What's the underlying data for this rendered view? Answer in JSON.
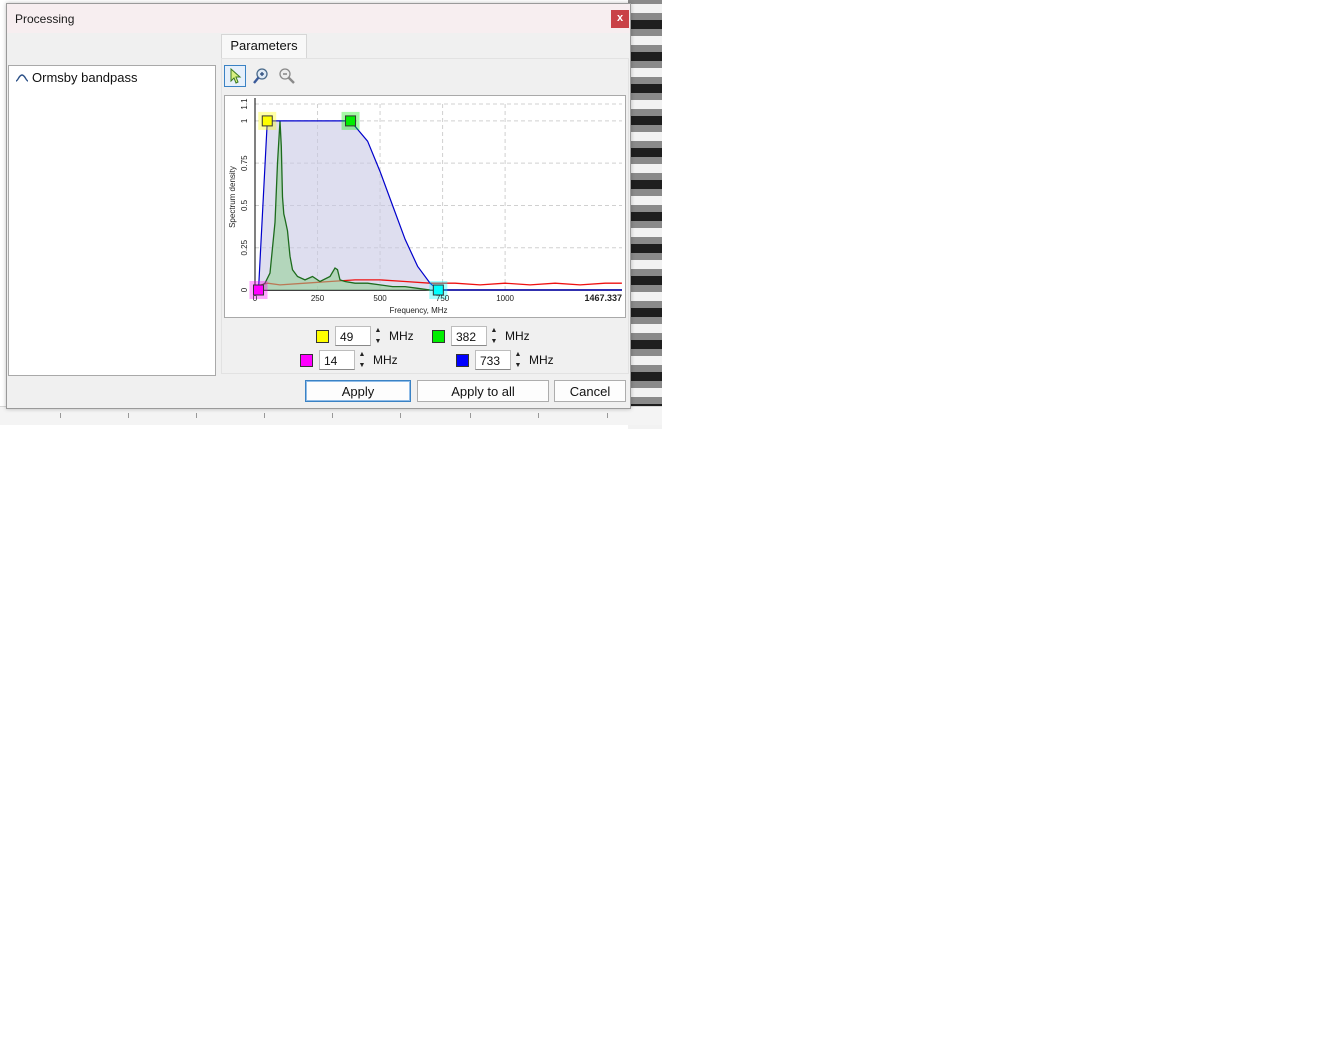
{
  "window": {
    "title": "Processing",
    "close_label": "x"
  },
  "filter_list": {
    "items": [
      {
        "label": "Ormsby bandpass",
        "icon": "bandpass-wave-icon"
      }
    ]
  },
  "tabs": [
    {
      "label": "Parameters"
    }
  ],
  "toolbar": {
    "tools": [
      "pointer-icon",
      "zoom-in-icon",
      "zoom-out-icon"
    ]
  },
  "chart_data": {
    "type": "area",
    "title": "",
    "xlabel": "Frequency, MHz",
    "ylabel": "Spectrum density",
    "xlim": [
      0,
      1467.337
    ],
    "ylim": [
      0,
      1.1
    ],
    "x_ticks": [
      "0",
      "250",
      "500",
      "750",
      "1000"
    ],
    "x_max_label": "1467.337",
    "y_ticks": [
      "0",
      "0.25",
      "0.5",
      "0.75",
      "1",
      "1.1"
    ],
    "grid": true,
    "series": [
      {
        "color": "#0000cc",
        "x": [
          0,
          14,
          49,
          382,
          450,
          500,
          550,
          600,
          650,
          700,
          733,
          1467.337
        ],
        "y": [
          0,
          0,
          1,
          1,
          0.88,
          0.7,
          0.5,
          0.3,
          0.14,
          0.04,
          0,
          0
        ]
      },
      {
        "color": "#ee1111",
        "x": [
          0,
          50,
          100,
          200,
          300,
          400,
          500,
          600,
          700,
          800,
          900,
          1000,
          1100,
          1200,
          1300,
          1400,
          1467
        ],
        "y": [
          0.02,
          0.04,
          0.03,
          0.04,
          0.05,
          0.06,
          0.06,
          0.05,
          0.04,
          0.04,
          0.03,
          0.04,
          0.03,
          0.04,
          0.03,
          0.04,
          0.04
        ]
      },
      {
        "color": "#1d6b1d",
        "x": [
          0,
          20,
          40,
          60,
          80,
          90,
          100,
          105,
          110,
          115,
          120,
          130,
          140,
          150,
          170,
          200,
          230,
          260,
          300,
          320,
          330,
          340,
          360,
          400,
          450,
          500,
          550,
          600,
          650,
          700
        ],
        "y": [
          0.01,
          0.02,
          0.04,
          0.1,
          0.4,
          0.75,
          1.0,
          0.85,
          0.55,
          0.45,
          0.42,
          0.35,
          0.2,
          0.12,
          0.08,
          0.06,
          0.08,
          0.05,
          0.08,
          0.13,
          0.12,
          0.06,
          0.05,
          0.04,
          0.04,
          0.03,
          0.02,
          0.02,
          0.01,
          0.0
        ]
      }
    ],
    "markers": [
      {
        "color": "#ffff00",
        "x": 49,
        "y": 1
      },
      {
        "color": "#00ee00",
        "x": 382,
        "y": 1
      },
      {
        "color": "#ff00ff",
        "x": 14,
        "y": 0
      },
      {
        "color": "#00ffff",
        "x": 733,
        "y": 0
      }
    ]
  },
  "parameters": {
    "unit": "MHz",
    "fields": [
      {
        "color": "#ffff00",
        "value": "49"
      },
      {
        "color": "#00ee00",
        "value": "382"
      },
      {
        "color": "#ff00ff",
        "value": "14"
      },
      {
        "color": "#0000ff",
        "value": "733"
      }
    ]
  },
  "buttons": {
    "apply": "Apply",
    "apply_all": "Apply to all",
    "cancel": "Cancel"
  }
}
